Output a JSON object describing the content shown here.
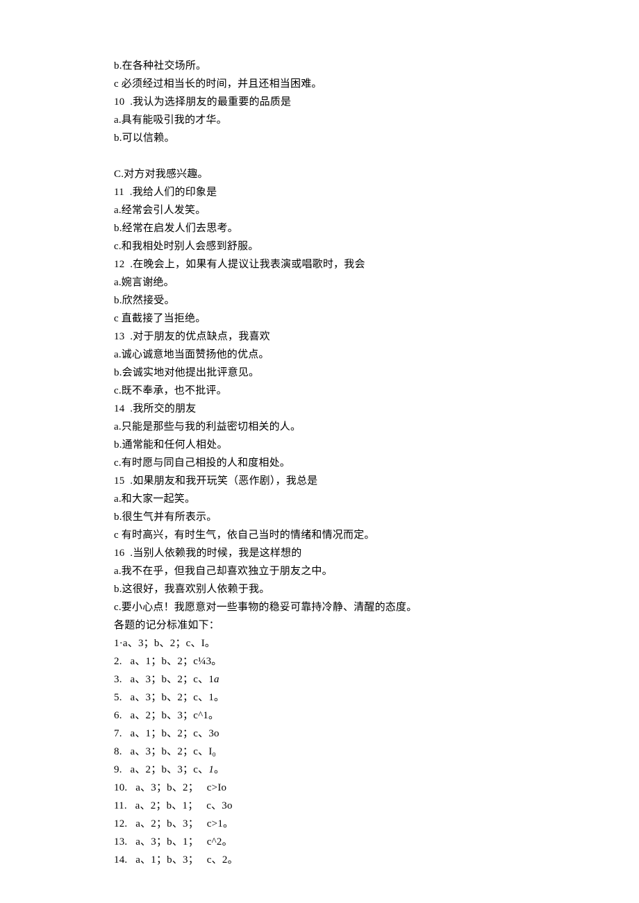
{
  "lines": [
    "b.在各种社交场所。",
    "c 必须经过相当长的时间，并且还相当困难。",
    "10  .我认为选择朋友的最重要的品质是",
    "a.具有能吸引我的才华。",
    "b.可以信赖。",
    "",
    "C.对方对我感兴趣。",
    "11  .我给人们的印象是",
    "a.经常会引人发笑。",
    "b.经常在启发人们去思考。",
    "c.和我相处时别人会感到舒服。",
    "12  .在晚会上，如果有人提议让我表演或唱歌时，我会",
    "a.婉言谢绝。",
    "b.欣然接受。",
    "c 直截接了当拒绝。",
    "13  .对于朋友的优点缺点，我喜欢",
    "a.诚心诚意地当面赞扬他的优点。",
    "b.会诚实地对他提出批评意见。",
    "c.既不奉承，也不批评。",
    "14  .我所交的朋友",
    "a.只能是那些与我的利益密切相关的人。",
    "b.通常能和任何人相处。",
    "c.有时愿与同自己相投的人和度相处。",
    "15  .如果朋友和我开玩笑（恶作剧），我总是",
    "a.和大家一起笑。",
    "b.很生气并有所表示。",
    "c 有时高兴，有时生气，依自己当时的情绪和情况而定。",
    "16  .当别人依赖我的时候，我是这样想的",
    "a.我不在乎，但我自己却喜欢独立于朋友之中。",
    "b.这很好，我喜欢别人依赖于我。",
    "c.要小心点！我愿意对一些事物的稳妥可靠持冷静、清醒的态度。",
    "各题的记分标准如下：",
    "1·a、3；b、2；c、I。",
    "2.   a、1；b、2；c¼3。",
    "3.   a、3；b、2；c、1{italic}a{/italic}",
    "5.   a、3；b、2；c、1。",
    "6.   a、2；b、3；c^1。",
    "7.   a、1；b、2；c、3o",
    "8.   a、3；b、2；c、I₀",
    "9.   a、2；b、3；c、{italic}1{/italic}。",
    "10.   a、3；b、2；   c>Io",
    "11.   a、2；b、1；   c、3o",
    "12.   a、2；b、3；   c>1。",
    "13.   a、3；b、1；   c^2。",
    "14.   a、1；b、3；   c、2。"
  ]
}
